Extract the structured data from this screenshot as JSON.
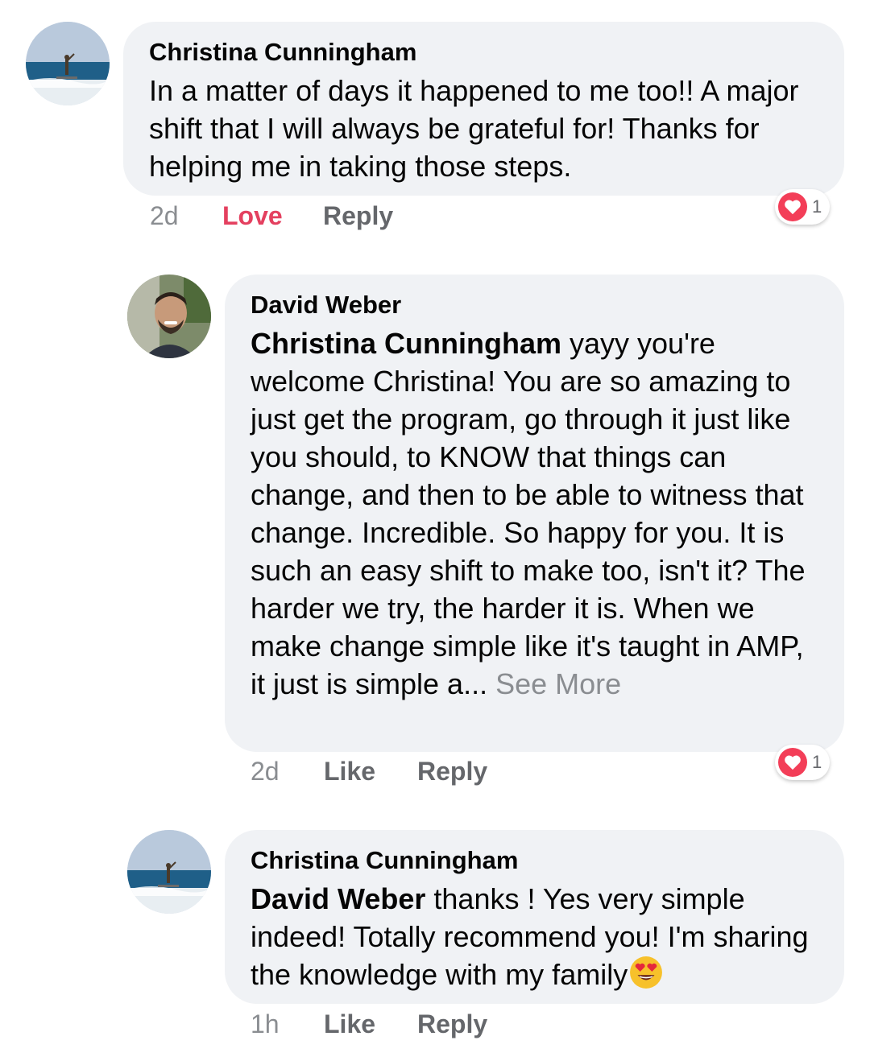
{
  "comments": [
    {
      "author": "Christina Cunningham",
      "text": "In a matter of days it happened to me too!! A major shift that I will always be grateful for! Thanks for helping me in taking those steps.",
      "time": "2d",
      "reaction_label": "Love",
      "reply_label": "Reply",
      "reaction_count": "1"
    },
    {
      "author": "David Weber",
      "mention": "Christina Cunningham",
      "text": " yayy you're welcome Christina!  You are so amazing to just get the program, go through it just like you should, to KNOW that things can change, and then to be able to witness that change.  Incredible.  So happy for you.  It is such an easy shift to make too, isn't it?  The harder we try, the harder it is.  When we make change simple like it's taught in AMP, it just is simple a...",
      "see_more": " See More",
      "time": "2d",
      "reaction_label": "Like",
      "reply_label": "Reply",
      "reaction_count": "1"
    },
    {
      "author": "Christina Cunningham",
      "mention": "David Weber",
      "text": " thanks ! Yes very simple indeed! Totally recommend you! I'm sharing the knowledge with my family",
      "emoji": "heart-eyes-emoji",
      "time": "1h",
      "reaction_label": "Like",
      "reply_label": "Reply"
    }
  ],
  "colors": {
    "bubble": "#f0f2f5",
    "love": "#e4405f",
    "heart_badge": "#f33e58",
    "muted": "#65676b"
  },
  "icons": {
    "reaction": "heart-reaction-icon",
    "emoji": "heart-eyes-emoji"
  }
}
